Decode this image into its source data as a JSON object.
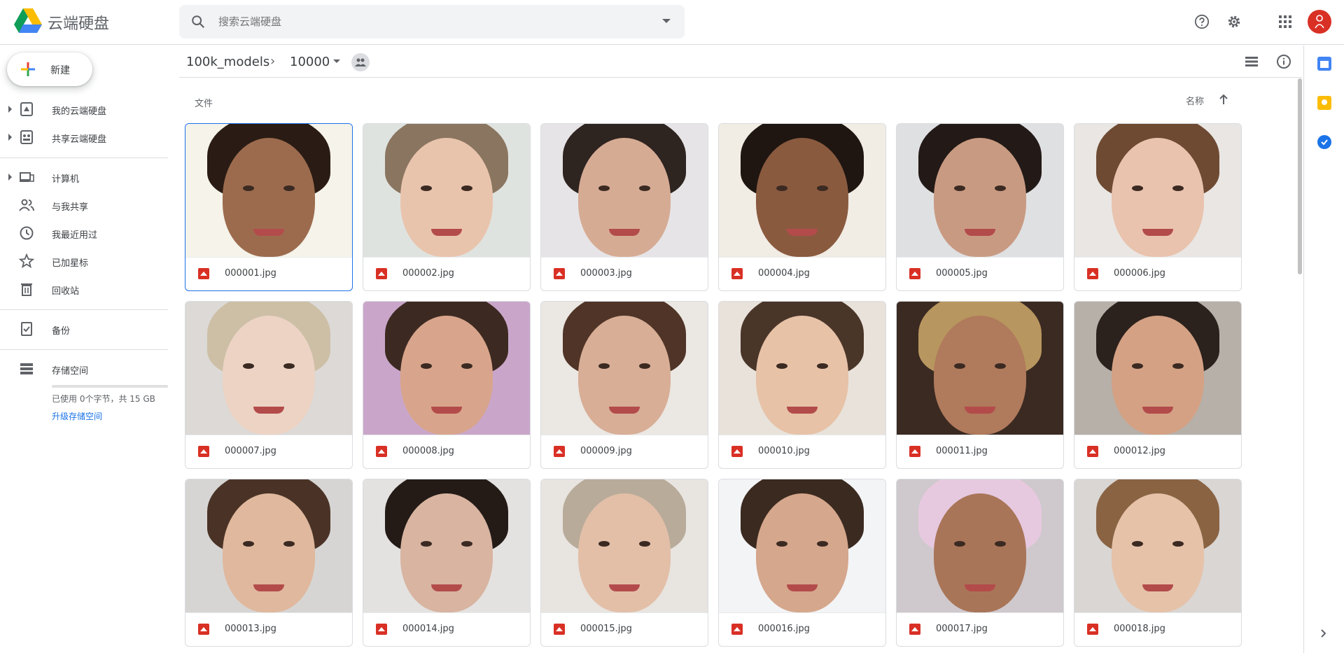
{
  "app": {
    "title": "云端硬盘",
    "logo_icon": "google-drive-logo"
  },
  "search": {
    "placeholder": "搜索云端硬盘",
    "value": ""
  },
  "header_icons": [
    "help-icon",
    "settings-icon",
    "apps-grid-icon",
    "account-avatar"
  ],
  "sidebar": {
    "new_button": "新建",
    "items": [
      {
        "label": "我的云端硬盘",
        "icon": "my-drive-icon",
        "expandable": true
      },
      {
        "label": "共享云端硬盘",
        "icon": "shared-drives-icon",
        "expandable": true
      },
      {
        "label": "计算机",
        "icon": "computers-icon",
        "expandable": true
      },
      {
        "label": "与我共享",
        "icon": "shared-with-me-icon",
        "expandable": false
      },
      {
        "label": "我最近用过",
        "icon": "recent-icon",
        "expandable": false
      },
      {
        "label": "已加星标",
        "icon": "starred-icon",
        "expandable": false
      },
      {
        "label": "回收站",
        "icon": "trash-icon",
        "expandable": false
      },
      {
        "label": "备份",
        "icon": "backup-icon",
        "expandable": false
      },
      {
        "label": "存储空间",
        "icon": "storage-icon",
        "expandable": false
      }
    ],
    "storage": {
      "usage_text": "已使用 0个字节，共 15 GB",
      "used_fraction": 0,
      "upgrade_link": "升级存储空间"
    }
  },
  "breadcrumb": {
    "parent": "100k_models",
    "current": "10000"
  },
  "toolbar_icons": [
    "list-view-icon",
    "info-icon"
  ],
  "files_section": {
    "heading": "文件",
    "sort_by": "名称",
    "sort_direction": "ascending"
  },
  "files": [
    {
      "name": "000001.jpg",
      "selected": true,
      "bg": "#f5f3ea",
      "skin": "#9c6b4e",
      "hair": "#2a1c14"
    },
    {
      "name": "000002.jpg",
      "selected": false,
      "bg": "#dfe3df",
      "skin": "#e9c4ad",
      "hair": "#8a7560"
    },
    {
      "name": "000003.jpg",
      "selected": false,
      "bg": "#e6e4e6",
      "skin": "#d6ab94",
      "hair": "#2e2420"
    },
    {
      "name": "000004.jpg",
      "selected": false,
      "bg": "#f1ece4",
      "skin": "#8a5a3f",
      "hair": "#1f1611"
    },
    {
      "name": "000005.jpg",
      "selected": false,
      "bg": "#dfe0e2",
      "skin": "#c99a82",
      "hair": "#231a17"
    },
    {
      "name": "000006.jpg",
      "selected": false,
      "bg": "#e9e6e3",
      "skin": "#e9c3ae",
      "hair": "#6e4a33"
    },
    {
      "name": "000007.jpg",
      "selected": false,
      "bg": "#dcd9d6",
      "skin": "#ecd3c4",
      "hair": "#cdbfa6"
    },
    {
      "name": "000008.jpg",
      "selected": false,
      "bg": "#c9a6c9",
      "skin": "#d8a58c",
      "hair": "#3c2a22"
    },
    {
      "name": "000009.jpg",
      "selected": false,
      "bg": "#ebe7e2",
      "skin": "#d8ae96",
      "hair": "#4f3427"
    },
    {
      "name": "000010.jpg",
      "selected": false,
      "bg": "#e8e2da",
      "skin": "#e7c2a7",
      "hair": "#4a3529"
    },
    {
      "name": "000011.jpg",
      "selected": false,
      "bg": "#3a2a22",
      "skin": "#b07a5c",
      "hair": "#b8965f"
    },
    {
      "name": "000012.jpg",
      "selected": false,
      "bg": "#b6b0a8",
      "skin": "#d4a184",
      "hair": "#2b211d"
    },
    {
      "name": "000013.jpg",
      "selected": false,
      "bg": "#d6d5d3",
      "skin": "#e0b89d",
      "hair": "#4a3326"
    },
    {
      "name": "000014.jpg",
      "selected": false,
      "bg": "#e4e2e0",
      "skin": "#d8b4a1",
      "hair": "#241b17"
    },
    {
      "name": "000015.jpg",
      "selected": false,
      "bg": "#e8e4df",
      "skin": "#e3bfa8",
      "hair": "#b8ab9a"
    },
    {
      "name": "000016.jpg",
      "selected": false,
      "bg": "#f3f4f6",
      "skin": "#d5a78c",
      "hair": "#3b2a20"
    },
    {
      "name": "000017.jpg",
      "selected": false,
      "bg": "#cfc8cc",
      "skin": "#a97558",
      "hair": "#e6c9df"
    },
    {
      "name": "000018.jpg",
      "selected": false,
      "bg": "#d9d6d3",
      "skin": "#e6c2a9",
      "hair": "#8a6343"
    }
  ],
  "right_rail": [
    "calendar-icon",
    "keep-icon",
    "tasks-icon",
    "expand-panel-icon"
  ],
  "colors": {
    "accent": "#1a73e8",
    "file_type": "#d93025",
    "avatar": "#d93025"
  }
}
